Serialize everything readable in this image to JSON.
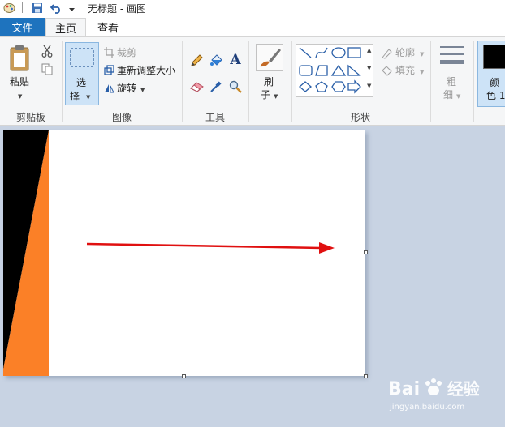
{
  "window": {
    "title": "无标题 - 画图"
  },
  "tabs": {
    "file": "文件",
    "home": "主页",
    "view": "查看"
  },
  "clipboard": {
    "paste": "粘贴",
    "group": "剪贴板"
  },
  "image": {
    "select_line1": "选",
    "select_line2": "择",
    "crop": "裁剪",
    "resize": "重新调整大小",
    "rotate": "旋转",
    "group": "图像"
  },
  "tools": {
    "group": "工具"
  },
  "brushes": {
    "line1": "刷",
    "line2": "子"
  },
  "shapes": {
    "outline": "轮廓",
    "fill": "填充",
    "group": "形状"
  },
  "size": {
    "line1": "粗",
    "line2": "细"
  },
  "colors": {
    "line1": "颜",
    "line2": "色 1",
    "color1": "#000000"
  },
  "canvas_content": {
    "black": "#000000",
    "orange": "#fb8027",
    "arrow_color": "#e01010"
  },
  "watermark": {
    "brand": "Bai",
    "brand2": "经验",
    "url": "jingyan.baidu.com"
  }
}
